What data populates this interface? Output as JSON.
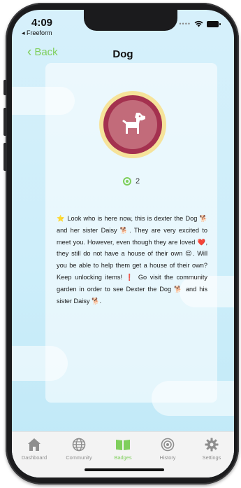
{
  "status": {
    "time": "4:09",
    "back_app": "◂ Freeform"
  },
  "nav": {
    "back_label": "Back",
    "title": "Dog"
  },
  "badge": {
    "icon": "dog-icon",
    "points": "2"
  },
  "description": "⭐ Look who is here now, this is dexter the Dog 🐕and her sister Daisy 🐕. They are very excited to meet you. However, even though they are loved ❤️, they still do not have a house of their own 😔. Will you be able to help them get a house of their own? Keep unlocking items! ❗ Go visit the community garden in order to see Dexter the Dog 🐕 and his sister Daisy 🐕.",
  "tabs": [
    {
      "label": "Dashboard",
      "icon": "house-icon"
    },
    {
      "label": "Community",
      "icon": "globe-icon"
    },
    {
      "label": "Badges",
      "icon": "book-icon",
      "active": true
    },
    {
      "label": "History",
      "icon": "target-icon"
    },
    {
      "label": "Settings",
      "icon": "gear-icon"
    }
  ],
  "colors": {
    "accent": "#7fcf5c",
    "badge_ring": "#f6e39a",
    "badge_dark": "#a4314f",
    "badge_light": "#c26b7a"
  }
}
